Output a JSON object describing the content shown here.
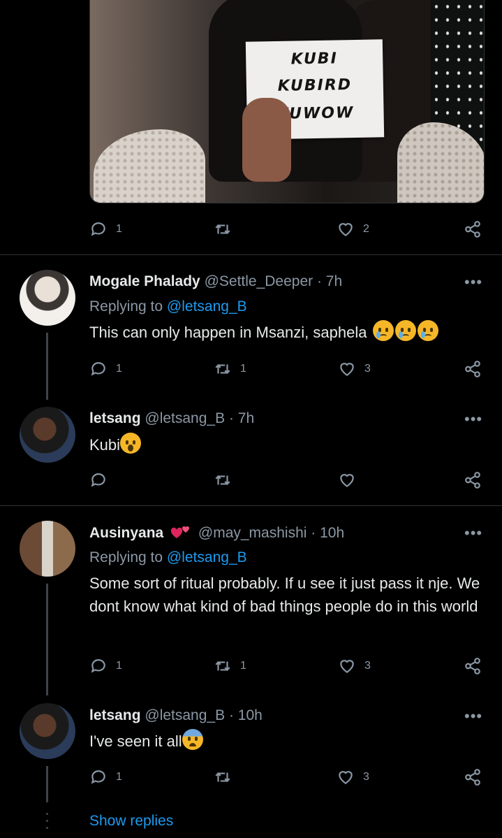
{
  "media": {
    "card_lines": [
      "KUBI",
      "KUBIRD",
      "KUWOW"
    ]
  },
  "top_tweet_actions": {
    "replies": "1",
    "retweets": "",
    "likes": "2"
  },
  "tweets": [
    {
      "name": "Mogale Phalady",
      "handle": "@Settle_Deeper",
      "time": "· 7h",
      "replying_prefix": "Replying to ",
      "replying_to": "@letsang_B",
      "text": "This can only happen in Msanzi, saphela",
      "emoji": "crying-face x3",
      "replies": "1",
      "retweets": "1",
      "likes": "3"
    },
    {
      "name": "letsang",
      "handle": "@letsang_B",
      "time": "· 7h",
      "text": "Kubi",
      "emoji": "screaming-face",
      "replies": "",
      "retweets": "",
      "likes": ""
    },
    {
      "name": "Ausinyana",
      "handle": "@may_mashishi",
      "time": "· 10h",
      "replying_prefix": "Replying to ",
      "replying_to": "@letsang_B",
      "text": "Some sort of ritual probably. If u see it just pass it nje. We dont know what kind of bad things people do in this world",
      "replies": "1",
      "retweets": "1",
      "likes": "3"
    },
    {
      "name": "letsang",
      "handle": "@letsang_B",
      "time": "· 10h",
      "text": "I've seen it all",
      "emoji": "anxious-face-with-sweat",
      "replies": "1",
      "retweets": "",
      "likes": "3"
    }
  ],
  "more_label": "•••",
  "show_replies": "Show replies",
  "colors": {
    "background": "#000000",
    "accent": "#1d9bf0",
    "muted": "#8b98a5",
    "text": "#e7e9ea"
  }
}
